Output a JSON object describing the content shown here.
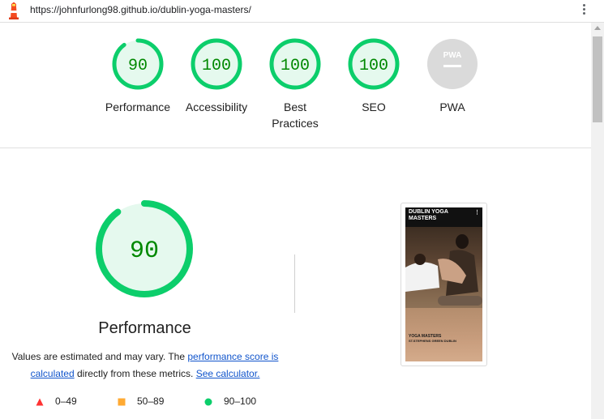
{
  "browser": {
    "url": "https://johnfurlong98.github.io/dublin-yoga-masters/"
  },
  "summary_gauges": [
    {
      "label": "Performance",
      "value": "90"
    },
    {
      "label": "Accessibility",
      "value": "100"
    },
    {
      "label": "Best Practices",
      "value": "100"
    },
    {
      "label": "SEO",
      "value": "100"
    },
    {
      "label": "PWA",
      "badge": "PWA"
    }
  ],
  "performance": {
    "score": "90",
    "score_fraction": 0.9,
    "title": "Performance",
    "desc_prefix": "Values are estimated and may vary. The ",
    "link_score": "performance score is calculated",
    "desc_middle": " directly from these metrics. ",
    "link_calc": "See calculator."
  },
  "legend": [
    {
      "range": "0–49",
      "shape": "triangle",
      "color": "#ff3333"
    },
    {
      "range": "50–89",
      "shape": "square",
      "color": "#ffaa33"
    },
    {
      "range": "90–100",
      "shape": "circle",
      "color": "#0cce6b"
    }
  ],
  "screenshot": {
    "site_title": "DUBLIN YOGA MASTERS",
    "menu": "⋮",
    "caption_line1": "YOGA MASTERS",
    "caption_line2": "ST.STEPHENS GREEN DUBLIN"
  },
  "colors": {
    "pass": "#0cce6b",
    "pass_text": "#008800",
    "pass_fill": "#e5f9ee",
    "na": "#dadada"
  }
}
